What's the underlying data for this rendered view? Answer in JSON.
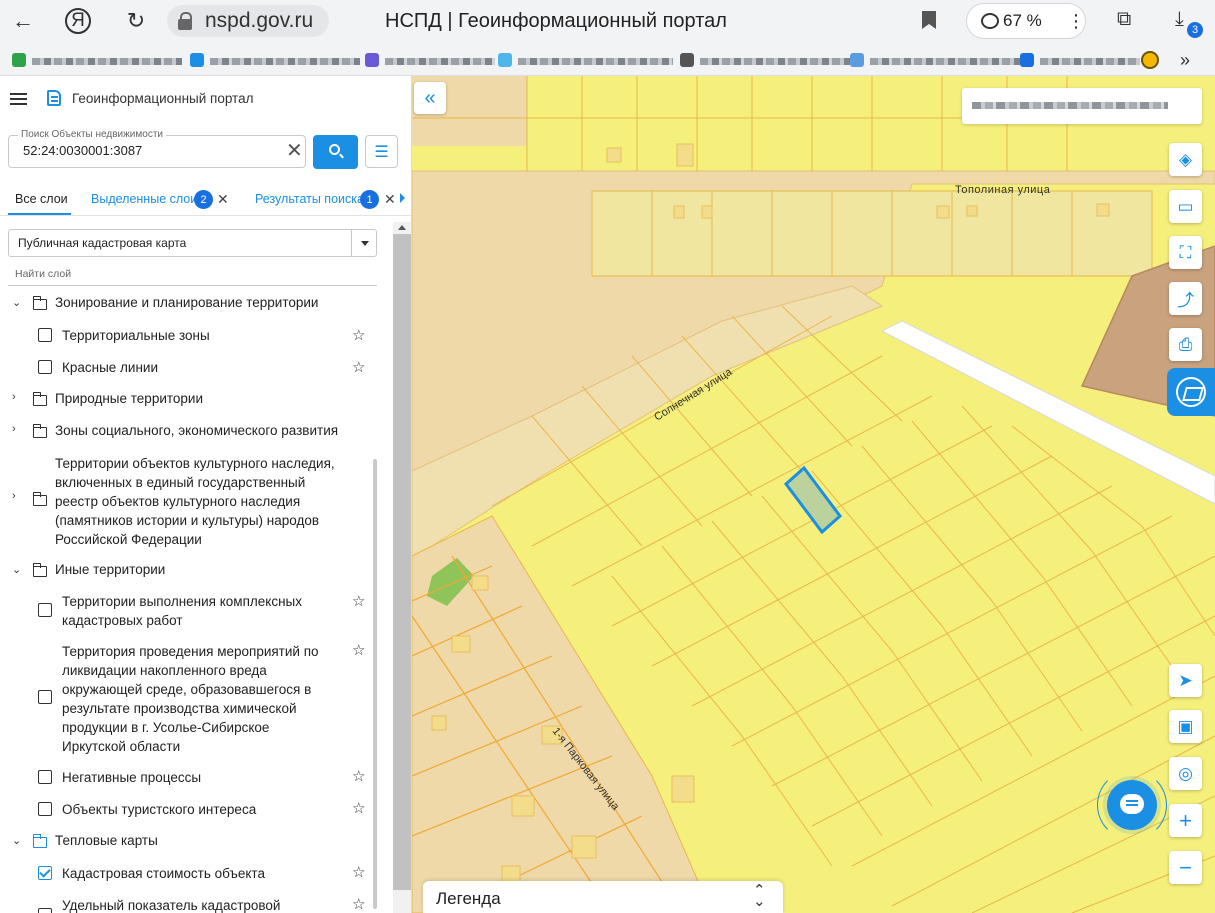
{
  "browser": {
    "url": "nspd.gov.ru",
    "title": "НСПД | Геоинформационный портал",
    "zoom": "67 %",
    "downloads_badge": "3",
    "more_label": "»"
  },
  "header": {
    "portal_name": "Геоинформационный портал"
  },
  "search": {
    "legend": "Поиск Объекты недвижимости",
    "value": "52:24:0030001:3087"
  },
  "tabs": {
    "all": "Все слои",
    "selected": "Выделенные слои",
    "selected_count": "2",
    "results": "Результаты поиска",
    "results_count": "1"
  },
  "layer_select": {
    "value": "Публичная кадастровая карта",
    "find_label": "Найти слой"
  },
  "tree": {
    "zoning": "Зонирование и планирование территории",
    "territorial_zones": "Территориальные зоны",
    "red_lines": "Красные линии",
    "natural": "Природные территории",
    "social_zones": "Зоны социального, экономического развития",
    "heritage_1": "Территории объектов культурного наследия,",
    "heritage_2": "включенных в единый государственный",
    "heritage_3": "реестр объектов культурного наследия",
    "heritage_4": "(памятников истории и культуры) народов",
    "heritage_5": "Российской Федерации",
    "other": "Иные территории",
    "complex_1": "Территории выполнения комплексных",
    "complex_2": "кадастровых работ",
    "harm_1": "Территория проведения мероприятий по",
    "harm_2": "ликвидации накопленного вреда",
    "harm_3": "окружающей среде, образовавшегося в",
    "harm_4": "результате производства химической",
    "harm_5": "продукции в г. Усолье-Сибирское",
    "harm_6": "Иркутской области",
    "negative": "Негативные процессы",
    "tourist": "Объекты туристского интереса",
    "heatmaps": "Тепловые карты",
    "cadastral_value": "Кадастровая стоимость объекта",
    "specific_value": "Удельный показатель кадастровой"
  },
  "map": {
    "street_1": "Тополиная улица",
    "street_2": "Солнечная улица",
    "street_3": "1-я Парковая улица",
    "legend": "Легенда",
    "collapse": "«",
    "colors": {
      "parcel": "#f5ef7c",
      "parcel_border": "#e8b84a",
      "road": "#efd9a8",
      "selected_fill": "#bcd29c",
      "selected_border": "#1a8fe3",
      "brown": "#c9a27e",
      "green": "#8fc45a"
    }
  }
}
